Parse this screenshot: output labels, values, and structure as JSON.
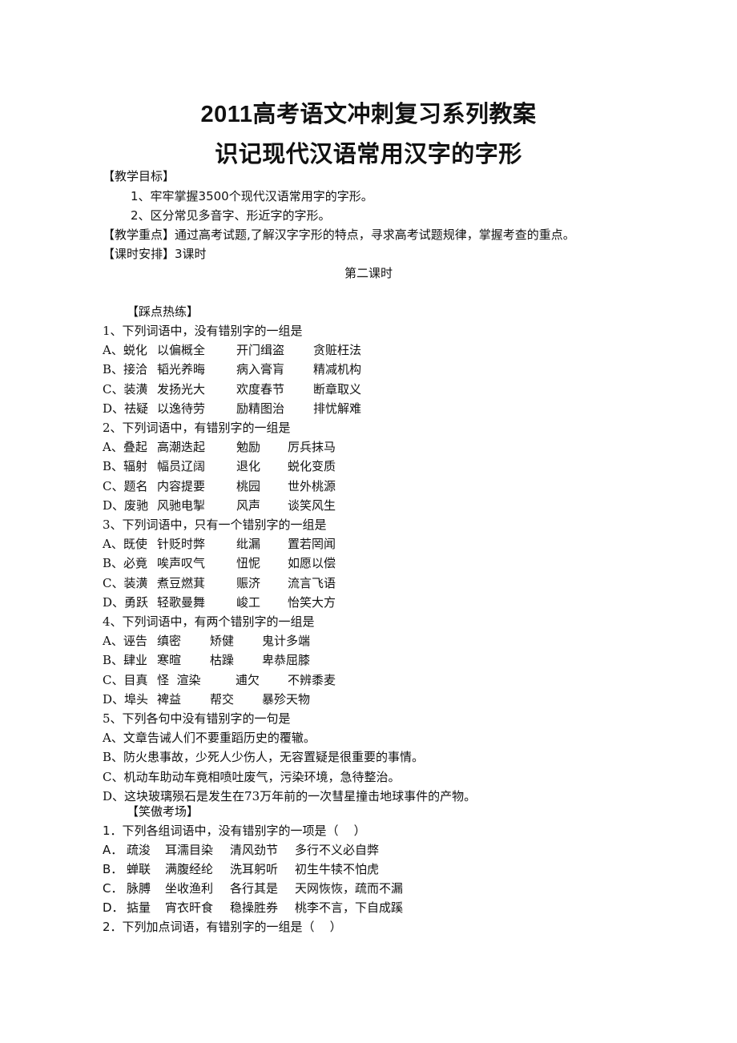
{
  "document": {
    "title_line1": "2011高考语文冲刺复习系列教案",
    "title_line2": "识记现代汉语常用汉字的字形",
    "objectives_heading": "【教学目标】",
    "objectives": [
      "1、牢牢掌握3500个现代汉语常用字的字形。",
      "2、区分常见多音字、形近字的字形。"
    ],
    "focus": "【教学重点】通过高考试题,了解汉字字形的特点，寻求高考试题规律，掌握考查的重点。",
    "schedule": "【课时安排】3课时",
    "lesson": "第二课时"
  },
  "practice": {
    "heading": "【踩点热练】",
    "questions": [
      {
        "stem": "1、下列词语中，没有错别字的一组是",
        "options": [
          [
            "A、蜕化",
            "以偏概全",
            "开门缉盗",
            "贪赃枉法"
          ],
          [
            "B、接洽",
            "韬光养晦",
            "病入膏肓",
            "精减机构"
          ],
          [
            "C、装潢",
            "发扬光大",
            "欢度春节",
            "断章取义"
          ],
          [
            "D、祛疑",
            "以逸待劳",
            "励精图治",
            "排忧解难"
          ]
        ]
      },
      {
        "stem": "2、下列词语中，有错别字的一组是",
        "options": [
          [
            "A、叠起",
            "高潮迭起",
            "勉励",
            "厉兵抹马"
          ],
          [
            "B、辐射",
            "幅员辽阔",
            "退化",
            "蜕化变质"
          ],
          [
            "C、题名",
            "内容提要",
            "桃园",
            "世外桃源"
          ],
          [
            "D、废驰",
            "风驰电掣",
            "风声",
            "谈笑风生"
          ]
        ]
      },
      {
        "stem": "3、下列词语中，只有一个错别字的一组是",
        "options": [
          [
            "A、既使",
            "针贬时弊",
            "纰漏",
            "置若罔闻"
          ],
          [
            "B、必竟",
            "唉声叹气",
            "忸怩",
            "如愿以偿"
          ],
          [
            "C、装潢",
            "煮豆燃萁",
            "赈济",
            "流言飞语"
          ],
          [
            "D、勇跃",
            "轻歌曼舞",
            "峻工",
            "怡笑大方"
          ]
        ]
      },
      {
        "stem": "4、下列词语中，有两个错别字的一组是",
        "options": [
          [
            "A、诬告",
            "缜密",
            "矫健",
            "鬼计多端"
          ],
          [
            "B、肆业",
            "寒暄",
            "枯躁",
            "卑恭屈膝"
          ],
          [
            "C、目真",
            "怪  渲染",
            "逋欠",
            "不辨黍麦"
          ],
          [
            "D、埠头",
            "裨益",
            "帮交",
            "暴殄天物"
          ]
        ]
      },
      {
        "stem": "5、下列各句中没有错别字的一句是",
        "sentences": [
          "A、文章告诫人们不要重蹈历史的覆辙。",
          "B、防火患事故，少死人少伤人，无容置疑是很重要的事情。",
          "C、机动车助动车竟相喷吐废气，污染环境，急待整治。",
          "D、这块玻璃殒石是发生在73万年前的一次彗星撞击地球事件的产物。"
        ]
      }
    ]
  },
  "exam": {
    "heading": "【笑傲考场】",
    "q1_stem": "1．下列各组词语中，没有错别字的一项是（    ）",
    "q1_options": [
      [
        "A．",
        "疏浚",
        "耳濡目染",
        "清风劲节",
        "多行不义必自弊"
      ],
      [
        "B．",
        "蝉联",
        "满腹经纶",
        "洗耳躬听",
        "初生牛犊不怕虎"
      ],
      [
        "C．",
        "脉膊",
        "坐收渔利",
        "各行其是",
        "天网恢恢，疏而不漏"
      ],
      [
        "D．",
        "掂量",
        "宵衣旰食",
        "稳操胜券",
        "桃李不言，下自成蹊"
      ]
    ],
    "q2_stem": "2．下列加点词语，有错别字的一组是（    ）"
  }
}
